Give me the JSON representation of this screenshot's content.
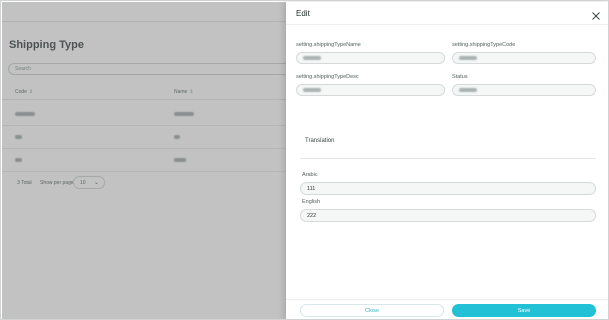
{
  "background": {
    "page_title": "Shipping Type",
    "search_placeholder": "Search",
    "columns": [
      {
        "label": "Code",
        "sort_icon": "sort-icon"
      },
      {
        "label": "Name",
        "sort_icon": "sort-icon"
      }
    ],
    "pagination": {
      "total": "3 Total",
      "per_page_label": "Show per page",
      "per_page_value": "10"
    }
  },
  "drawer": {
    "title": "Edit",
    "close_icon": "close-icon",
    "fields": {
      "name_label": "setting.shippingTypeName",
      "code_label": "setting.shippingTypeCode",
      "desc_label": "setting.shippingTypeDesc",
      "status_label": "Status"
    },
    "translation": {
      "title": "Translation",
      "arabic_label": "Arabic",
      "arabic_value": "111",
      "english_label": "English",
      "english_value": "222"
    },
    "buttons": {
      "close_label": "Close",
      "save_label": "Save"
    }
  },
  "colors": {
    "accent": "#22c1d6",
    "close_text": "#37b8c8"
  }
}
